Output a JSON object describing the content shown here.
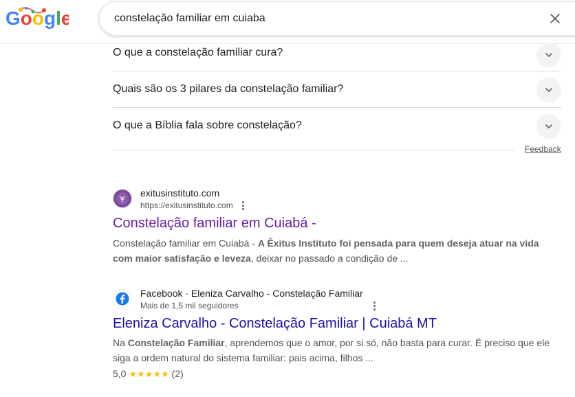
{
  "search": {
    "query": "constelação familiar em cuiaba",
    "clear_icon": "close-icon"
  },
  "logo": {
    "text": "Google"
  },
  "people_also_ask": {
    "questions": [
      "O que a constelação familiar cura?",
      "Quais são os 3 pilares da constelação familiar?",
      "O que a Bíblia fala sobre constelação?"
    ],
    "feedback_label": "Feedback"
  },
  "results": [
    {
      "site_name": "exitusinstituto.com",
      "url": "https://exitusinstituto.com",
      "title": "Constelação familiar em Cuiabá -",
      "snippet_parts": [
        "Constelação familiar em Cuiabá - ",
        "A Êxitus Instituto foi pensada para quem deseja atuar na vida com maior satisfação e leveza",
        ", deixar no passado a condição de ..."
      ]
    },
    {
      "site_name": "Facebook · Eleniza Carvalho - Constelação Familiar",
      "url": "Mais de 1,5 mil seguidores",
      "title": "Eleniza Carvalho - Constelação Familiar | Cuiabá MT",
      "snippet_parts": [
        "Na ",
        "Constelação Familiar",
        ", aprendemos que o amor, por si só, não basta para curar. É preciso que ele siga a ordem natural do sistema familiar: pais acima, filhos ..."
      ],
      "rating_value": "5,0",
      "rating_stars": "★★★★★",
      "rating_count": "(2)"
    }
  ],
  "colors": {
    "link": "#1a0dab",
    "visited": "#681da8",
    "star": "#fbbc04",
    "facebook": "#1877f2"
  }
}
